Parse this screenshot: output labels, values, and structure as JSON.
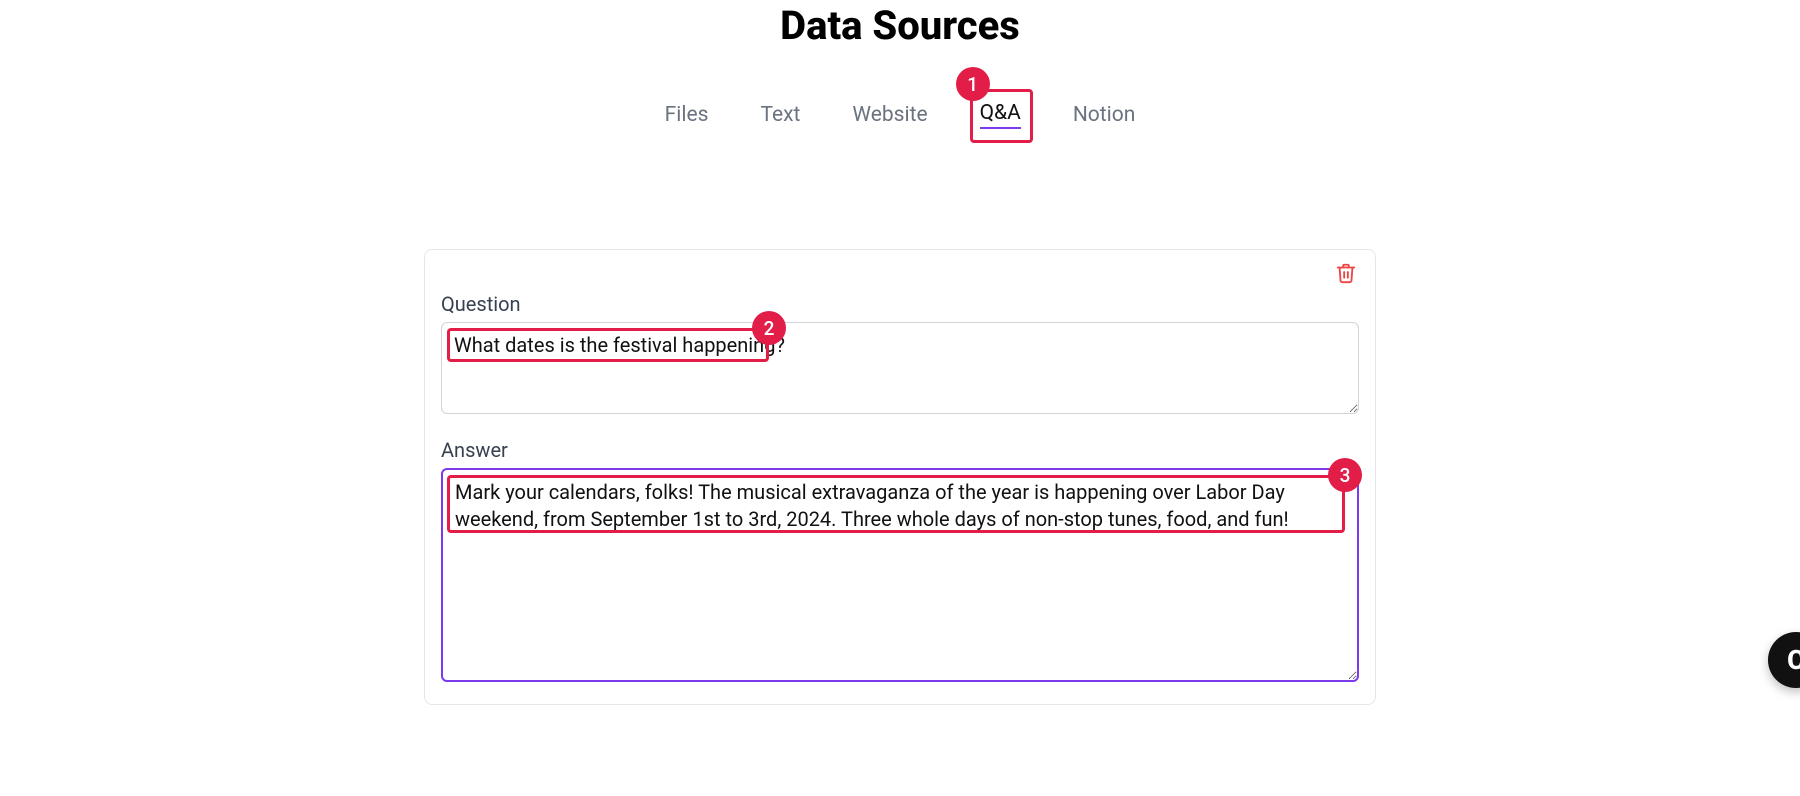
{
  "page": {
    "title": "Data Sources"
  },
  "tabs": {
    "items": [
      "Files",
      "Text",
      "Website",
      "Q&A",
      "Notion"
    ],
    "active_index": 3
  },
  "annotations": {
    "badge1": "1",
    "badge2": "2",
    "badge3": "3"
  },
  "qa": {
    "question_label": "Question",
    "answer_label": "Answer",
    "question_value": "What dates is the festival happening?",
    "answer_value": "Mark your calendars, folks! The musical extravaganza of the year is happening over Labor Day weekend, from September 1st to 3rd, 2024. Three whole days of non-stop tunes, food, and fun!"
  },
  "chat": {
    "letter": "C"
  }
}
